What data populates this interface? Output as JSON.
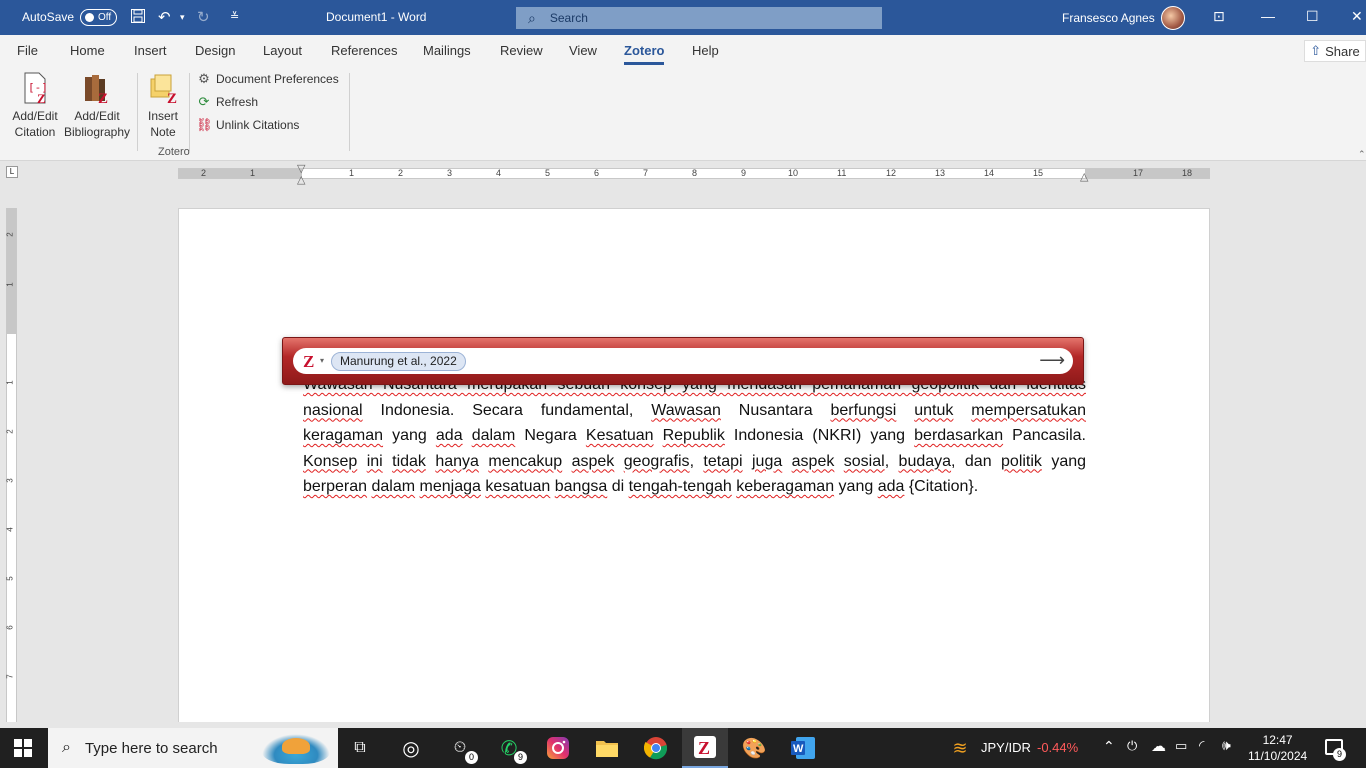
{
  "titlebar": {
    "autosave_label": "AutoSave",
    "autosave_state": "Off",
    "doc_title": "Document1  -  Word",
    "search_placeholder": "Search",
    "user_name": "Fransesco Agnes"
  },
  "menu": {
    "tabs": [
      "File",
      "Home",
      "Insert",
      "Design",
      "Layout",
      "References",
      "Mailings",
      "Review",
      "View",
      "Zotero",
      "Help"
    ],
    "active_tab": "Zotero",
    "share_label": "Share"
  },
  "ribbon": {
    "add_edit_citation": [
      "Add/Edit",
      "Citation"
    ],
    "add_edit_bibliography": [
      "Add/Edit",
      "Bibliography"
    ],
    "insert_note": [
      "Insert",
      "Note"
    ],
    "document_preferences": "Document Preferences",
    "refresh": "Refresh",
    "unlink_citations": "Unlink Citations",
    "group_label": "Zotero"
  },
  "ruler": {
    "h_numbers": [
      "2",
      "1",
      "1",
      "2",
      "3",
      "4",
      "5",
      "6",
      "7",
      "8",
      "9",
      "10",
      "11",
      "12",
      "13",
      "14",
      "15",
      "17",
      "18"
    ],
    "v_numbers": [
      "2",
      "1",
      "1",
      "2",
      "3",
      "4",
      "5",
      "6",
      "7"
    ]
  },
  "document": {
    "line1": "Wawasan Nusantara merupakan sebuah konsep yang mendasari pemahaman geopolitik dan identitas",
    "line2_a": "nasional",
    "line2_b": " Indonesia. Secara fundamental, ",
    "line2_c": "Wawasan",
    "line2_d": " Nusantara ",
    "line2_e": "berfungsi",
    "line2_f": " ",
    "line2_g": "untuk",
    "line2_h": " ",
    "line2_i": "mempersatukan",
    "line3_a": "keragaman",
    "line3_b": " yang ",
    "line3_c": "ada",
    "line3_d": " ",
    "line3_e": "dalam",
    "line3_f": " Negara ",
    "line3_g": "Kesatuan",
    "line3_h": " ",
    "line3_i": "Republik",
    "line3_j": " Indonesia (NKRI) yang ",
    "line3_k": "berdasarkan",
    "line3_l": " Pancasila.",
    "line4_a": "Konsep",
    "line4_b": " ",
    "line4_c": "ini",
    "line4_d": " ",
    "line4_e": "tidak",
    "line4_f": " ",
    "line4_g": "hanya",
    "line4_h": " ",
    "line4_i": "mencakup",
    "line4_j": " ",
    "line4_k": "aspek",
    "line4_l": " ",
    "line4_m": "geografis",
    "line4_n": ", ",
    "line4_o": "tetapi",
    "line4_p": " ",
    "line4_q": "juga",
    "line4_r": " ",
    "line4_s": "aspek",
    "line4_t": " ",
    "line4_u": "sosial",
    "line4_v": ", ",
    "line4_w": "budaya",
    "line4_x": ", dan ",
    "line4_y": "politik",
    "line4_z": " yang",
    "line5_a": "berperan",
    "line5_b": " ",
    "line5_c": "dalam",
    "line5_d": " ",
    "line5_e": "menjaga",
    "line5_f": " ",
    "line5_g": "kesatuan",
    "line5_h": " ",
    "line5_i": "bangsa",
    "line5_j": " di ",
    "line5_k": "tengah-tengah",
    "line5_l": " ",
    "line5_m": "keberagaman",
    "line5_n": " yang ",
    "line5_o": "ada",
    "line5_p": " {Citation}."
  },
  "zotero": {
    "logo": "Z",
    "citation_bubble": "Manurung et al., 2022"
  },
  "taskbar": {
    "search_placeholder": "Type here to search",
    "badge_clock": "0",
    "badge_whatsapp": "9",
    "currency_pair": "JPY/IDR",
    "currency_change": "-0.44%",
    "time": "12:47",
    "date": "11/10/2024",
    "notification_count": "9"
  },
  "colors": {
    "word_blue": "#2b579a",
    "zotero_red": "#b42828",
    "negative": "#ff5a5a"
  }
}
